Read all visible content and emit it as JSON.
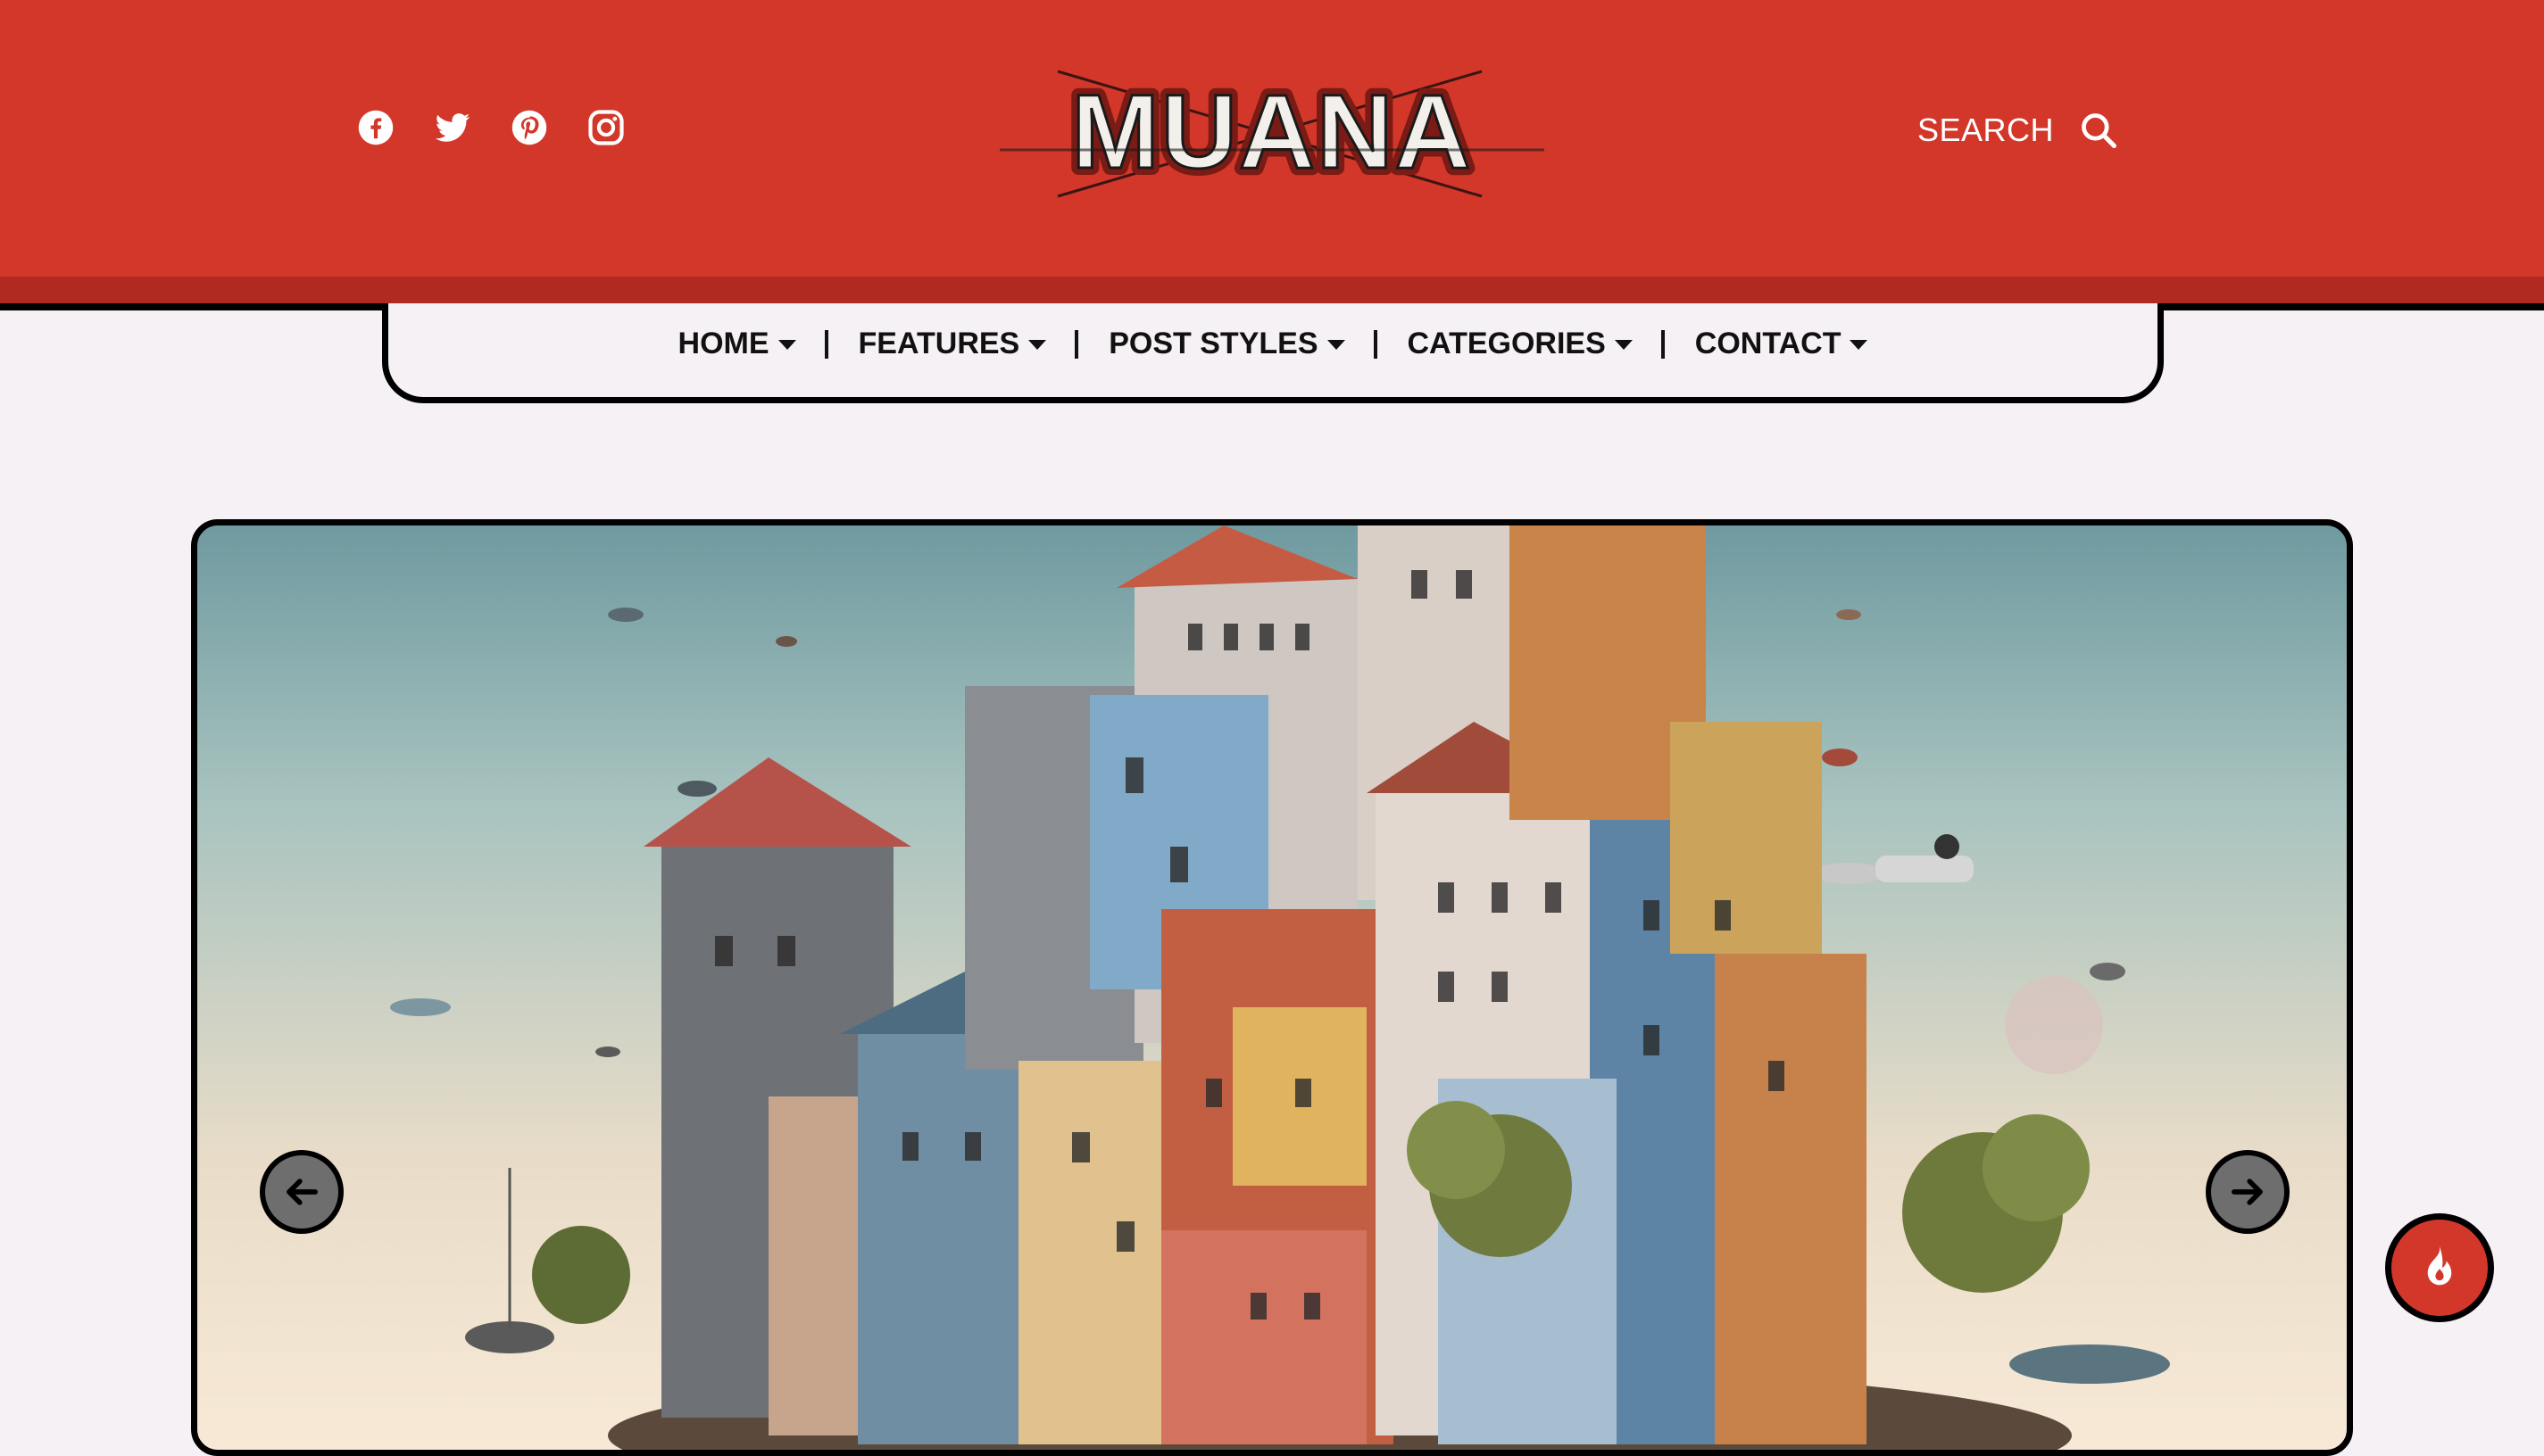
{
  "header": {
    "logo_text": "MUANA",
    "social_icons": [
      "facebook-icon",
      "twitter-icon",
      "pinterest-icon",
      "instagram-icon"
    ],
    "search_label": "SEARCH",
    "search_icon": "search-icon"
  },
  "nav": {
    "items": [
      {
        "label": "HOME"
      },
      {
        "label": "FEATURES"
      },
      {
        "label": "POST STYLES"
      },
      {
        "label": "CATEGORIES"
      },
      {
        "label": "CONTACT"
      }
    ]
  },
  "slider": {
    "image_subject": "stacked colorful houses floating island",
    "prev_icon": "arrow-left-icon",
    "next_icon": "arrow-right-icon"
  },
  "floating": {
    "hot_icon": "flame-icon"
  },
  "colors": {
    "brand_red": "#d2372a",
    "brand_red_dark": "#b02a22",
    "page_bg": "#f5f1f4",
    "outline": "#000000",
    "arrow_bg": "#6e6e6e"
  }
}
